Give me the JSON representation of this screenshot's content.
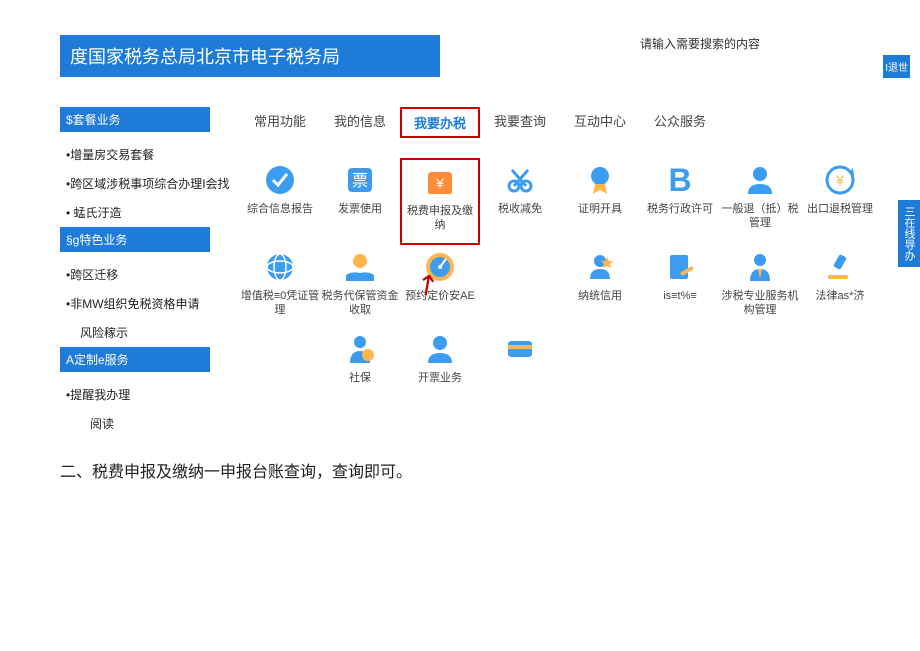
{
  "header": {
    "title": "度国家税务总局北京市电子税务局"
  },
  "search": {
    "placeholder": "请输入需要搜索的内容"
  },
  "exit": "I退世",
  "sideTab": "三在线导办",
  "sidebar": {
    "sec1": {
      "header": "$套餐业务",
      "items": [
        "•增量房交易套餐",
        "•跨区域涉税事项综合办理I会找",
        "•  蜢氏汙造"
      ]
    },
    "sec2": {
      "header": "§g特色业务",
      "items": [
        "•跨区迁移",
        "•非MW组织免税资格申请",
        "风险稼示"
      ]
    },
    "sec3": {
      "header": "A定制e服务",
      "items": [
        "•提醒我办理",
        "阅读"
      ]
    }
  },
  "tabs": [
    "常用功能",
    "我的信息",
    "我要办税",
    "我要查询",
    "互动中心",
    "公众服务"
  ],
  "grid": {
    "r1": [
      "综合信息报告",
      "发票使用",
      "税费申报及缴纳",
      "税收减免",
      "证明开具",
      "税务行政许可"
    ],
    "r1b": "B",
    "r2": [
      "一般退（抵）税管理",
      "出口退税管理",
      "增值税≡0凭证管理",
      "税务代保管资金收取",
      "预约定价安AE"
    ],
    "r3": [
      "纳统信用",
      "is≡t%≡",
      "涉税专业服务机构管理",
      "法律as*济",
      "",
      "社保"
    ],
    "r4": [
      "开票业务",
      ""
    ]
  },
  "bottom": "二、税费申报及缴纳一申报台账查询，查询即可。"
}
